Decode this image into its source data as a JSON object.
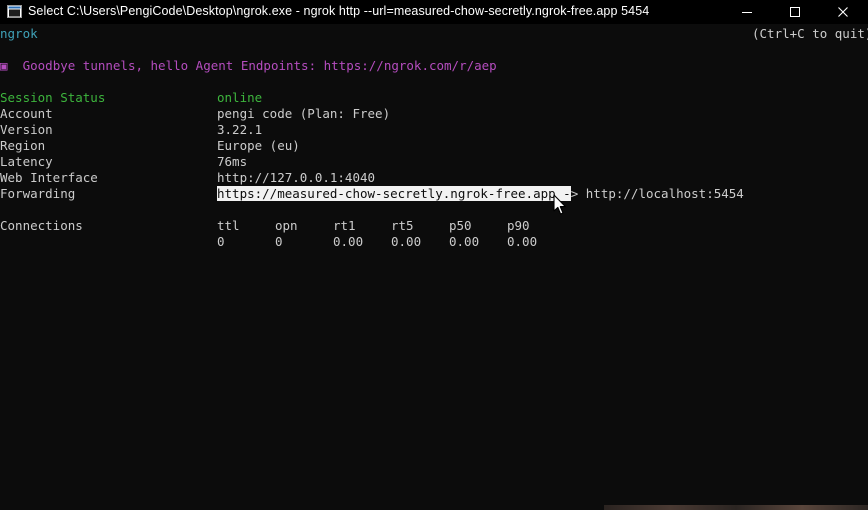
{
  "window": {
    "title": "Select C:\\Users\\PengiCode\\Desktop\\ngrok.exe - ngrok  http --url=measured-chow-secretly.ngrok-free.app 5454",
    "icon": "console-icon",
    "controls": [
      "minimize-icon",
      "maximize-icon",
      "close-icon"
    ]
  },
  "terminal": {
    "app_name": "ngrok",
    "quit_hint": "(Ctrl+C to quit)",
    "announcement": {
      "glyph": "▣",
      "text": "Goodbye tunnels, hello Agent Endpoints: https://ngrok.com/r/aep"
    },
    "session_status": {
      "label": "Session Status",
      "value": "online"
    },
    "account": {
      "label": "Account",
      "value": "pengi code (Plan: Free)"
    },
    "version": {
      "label": "Version",
      "value": "3.22.1"
    },
    "region": {
      "label": "Region",
      "value": "Europe (eu)"
    },
    "latency": {
      "label": "Latency",
      "value": "76ms"
    },
    "web_interface": {
      "label": "Web Interface",
      "value": "http://127.0.0.1:4040"
    },
    "forwarding": {
      "label": "Forwarding",
      "public_url": "https://measured-chow-secretly.ngrok-free.app",
      "selected_arrow_part": " -",
      "arrow_rest": "> ",
      "local_url": "http://localhost:5454"
    },
    "connections": {
      "label": "Connections",
      "headers": [
        "ttl",
        "opn",
        "rt1",
        "rt5",
        "p50",
        "p90"
      ],
      "values": [
        "0",
        "0",
        "0.00",
        "0.00",
        "0.00",
        "0.00"
      ]
    }
  },
  "colors": {
    "background": "#0c0c0c",
    "foreground": "#cccccc",
    "cyan": "#3fa2b8",
    "green": "#3db53d",
    "purple": "#b54dbf",
    "selection": "#f2f2f2"
  }
}
